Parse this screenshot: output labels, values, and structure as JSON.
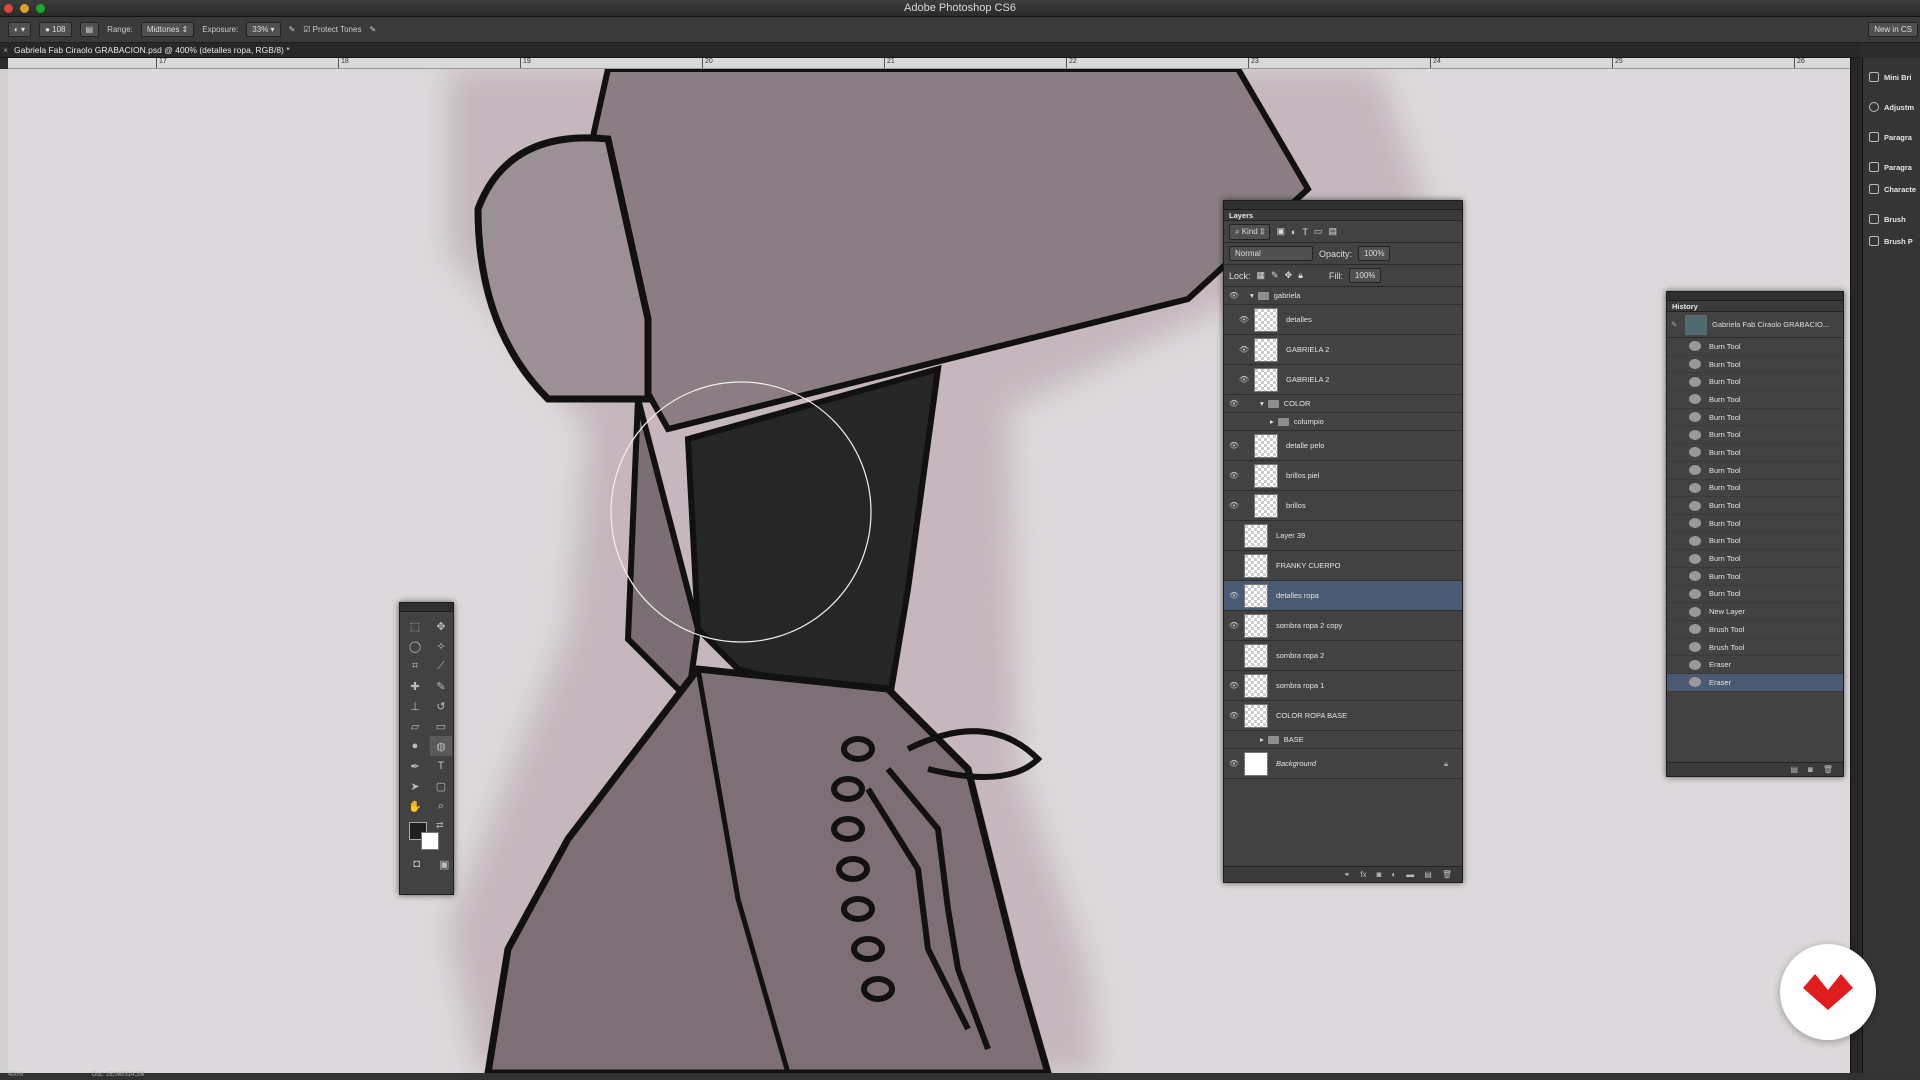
{
  "app": {
    "title": "Adobe Photoshop CS6",
    "new_in": "New in CS"
  },
  "options": {
    "brush_size": "108",
    "range_label": "Range:",
    "range_value": "Midtones",
    "exposure_label": "Exposure:",
    "exposure_value": "33%",
    "protect_tones": "Protect Tones"
  },
  "document": {
    "tab_title": "Gabriela Fab Ciraolo GRABACION.psd @ 400% (detalles ropa, RGB/8) *",
    "ruler_ticks": [
      "17",
      "18",
      "19",
      "20",
      "21",
      "22",
      "23",
      "24",
      "25",
      "26"
    ]
  },
  "status": {
    "zoom": "400%",
    "doc": "Doc: 16,0M/314,3M"
  },
  "dock": {
    "items": [
      "Mini Bri",
      "Adjustm",
      "Paragra",
      "Paragra",
      "Characte",
      "Brush",
      "Brush P"
    ]
  },
  "layers": {
    "title": "Layers",
    "kind": "Kind",
    "blend": "Normal",
    "opacity_label": "Opacity:",
    "opacity": "100%",
    "lock_label": "Lock:",
    "fill_label": "Fill:",
    "fill": "100%",
    "items": [
      {
        "name": "gabriela",
        "type": "group"
      },
      {
        "name": "detalles",
        "type": "layer"
      },
      {
        "name": "GABRIELA 2",
        "type": "layer"
      },
      {
        "name": "GABRIELA 2",
        "type": "layer"
      },
      {
        "name": "COLOR",
        "type": "group"
      },
      {
        "name": "columpio",
        "type": "group"
      },
      {
        "name": "detalle pelo",
        "type": "layer"
      },
      {
        "name": "brillos piel",
        "type": "layer"
      },
      {
        "name": "brillos",
        "type": "layer"
      },
      {
        "name": "Layer 39",
        "type": "layer"
      },
      {
        "name": "FRANKY CUERPO",
        "type": "layer"
      },
      {
        "name": "detalles ropa",
        "type": "layer",
        "selected": true
      },
      {
        "name": "sombra ropa 2 copy",
        "type": "layer"
      },
      {
        "name": "sombra ropa 2",
        "type": "layer"
      },
      {
        "name": "sombra ropa 1",
        "type": "layer"
      },
      {
        "name": "COLOR ROPA BASE",
        "type": "layer"
      },
      {
        "name": "BASE",
        "type": "group"
      },
      {
        "name": "Background",
        "type": "background"
      }
    ]
  },
  "history": {
    "title": "History",
    "snapshot": "Gabriela Fab Ciraolo GRABACIO...",
    "items": [
      "Burn Tool",
      "Burn Tool",
      "Burn Tool",
      "Burn Tool",
      "Burn Tool",
      "Burn Tool",
      "Burn Tool",
      "Burn Tool",
      "Burn Tool",
      "Burn Tool",
      "Burn Tool",
      "Burn Tool",
      "Burn Tool",
      "Burn Tool",
      "Burn Tool",
      "New Layer",
      "Brush Tool",
      "Brush Tool",
      "Eraser",
      "Eraser"
    ]
  },
  "colors": {
    "selection": "#4a5a73",
    "badge": "#e01c1c"
  }
}
